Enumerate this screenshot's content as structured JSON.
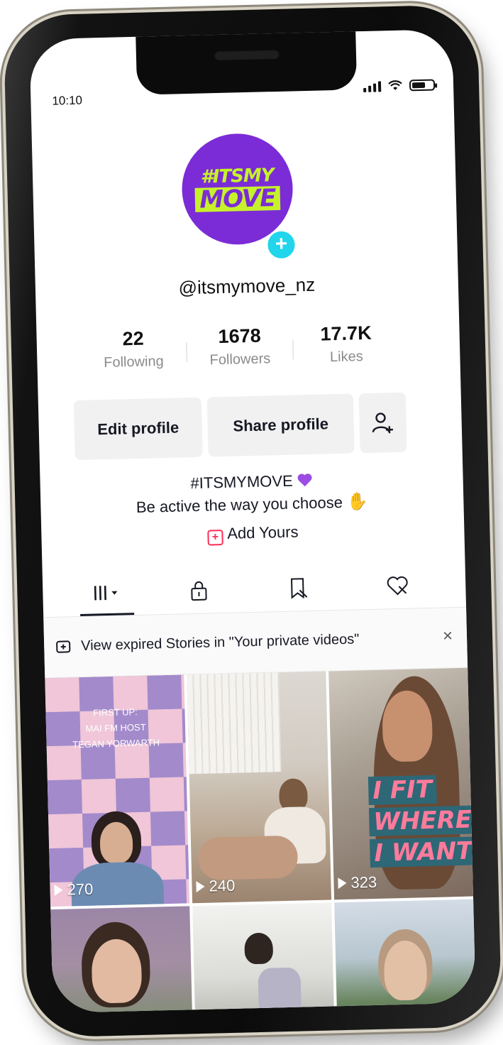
{
  "status_bar": {
    "time": "10:10"
  },
  "profile": {
    "logo_line1": "#ITSMY",
    "logo_line2": "MOVE",
    "username": "@itsmymove_nz"
  },
  "stats": [
    {
      "value": "22",
      "label": "Following"
    },
    {
      "value": "1678",
      "label": "Followers"
    },
    {
      "value": "17.7K",
      "label": "Likes"
    }
  ],
  "buttons": {
    "edit": "Edit profile",
    "share": "Share profile"
  },
  "bio": {
    "line1": "#ITSMYMOVE",
    "line2": "Be active the way you choose"
  },
  "add_yours": "Add Yours",
  "banner": {
    "text": "View expired Stories in \"Your private videos\"",
    "close": "×"
  },
  "videos": [
    {
      "views": "270",
      "overlay": [
        "FIRST UP:",
        "MAI FM HOST",
        "TEGAN YORWARTH"
      ]
    },
    {
      "views": "240"
    },
    {
      "views": "323",
      "overlay": [
        "I FIT",
        "WHERE",
        "I WANT"
      ]
    },
    {},
    {},
    {}
  ],
  "colors": {
    "brand_purple": "#7b2cd6",
    "brand_lime": "#c6f22b",
    "accent_cyan": "#20d5ec",
    "accent_red": "#fe2c55"
  }
}
